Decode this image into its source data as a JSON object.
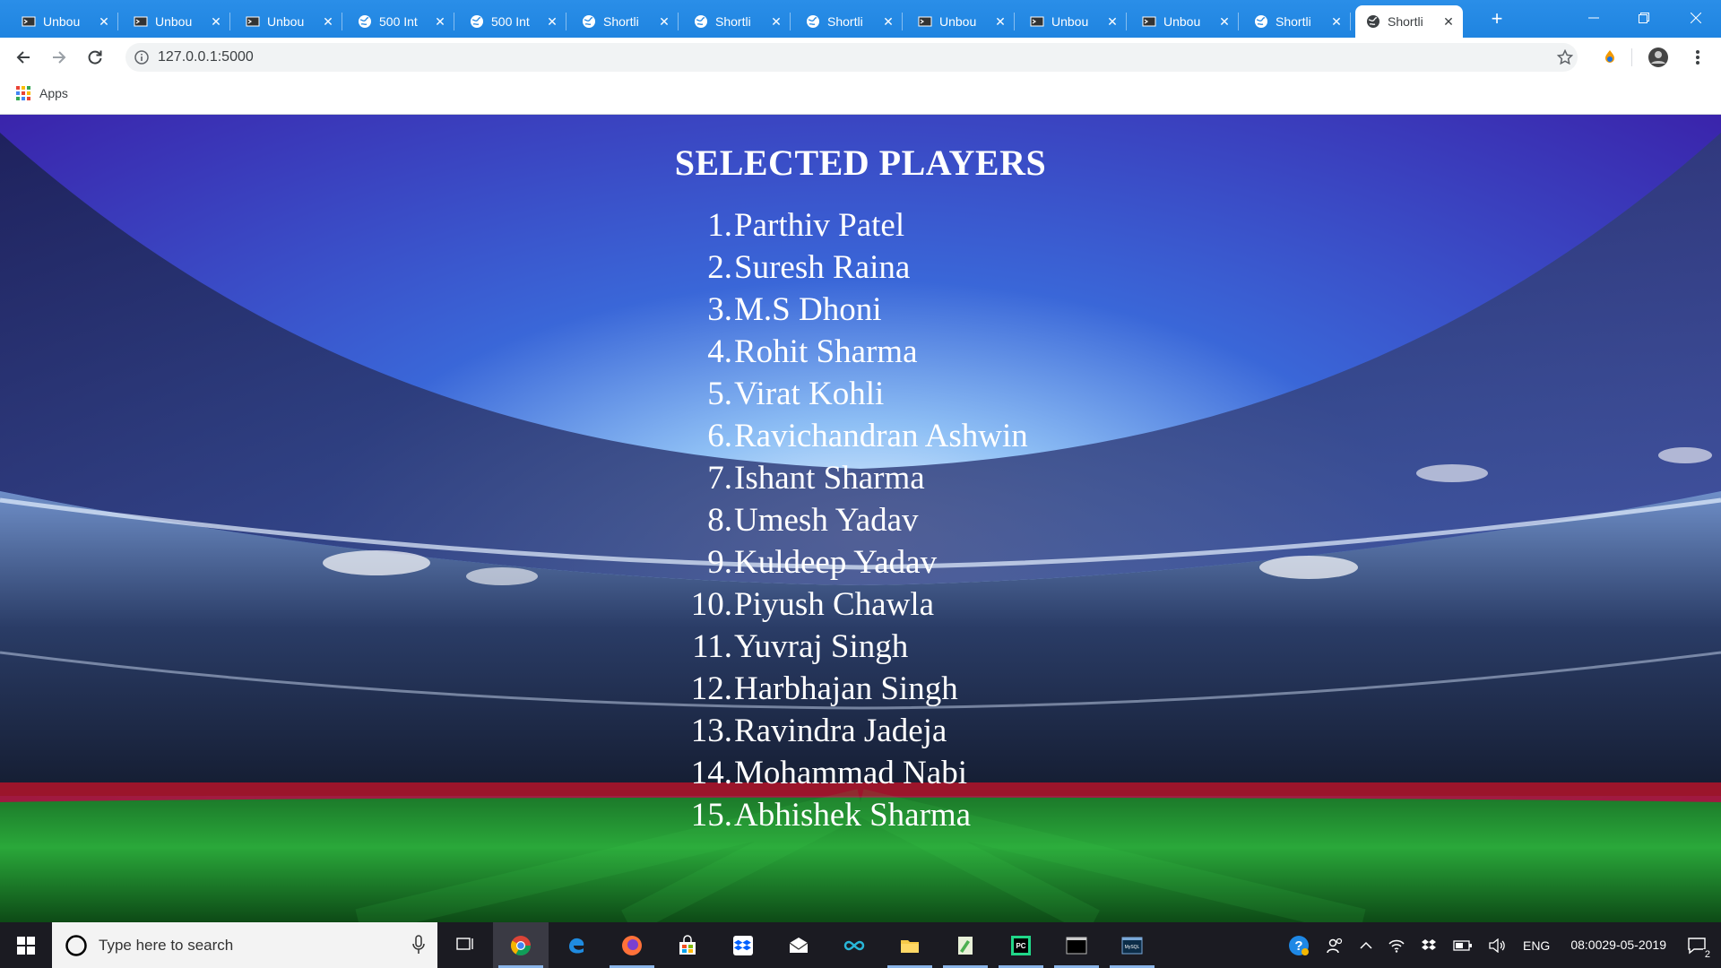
{
  "browser": {
    "tabs": [
      {
        "title": "Unbou",
        "icon": "terminal-icon",
        "active": false
      },
      {
        "title": "Unbou",
        "icon": "terminal-icon",
        "active": false
      },
      {
        "title": "Unbou",
        "icon": "terminal-icon",
        "active": false
      },
      {
        "title": "500 Int",
        "icon": "globe-icon",
        "active": false
      },
      {
        "title": "500 Int",
        "icon": "globe-icon",
        "active": false
      },
      {
        "title": "Shortli",
        "icon": "globe-icon",
        "active": false
      },
      {
        "title": "Shortli",
        "icon": "globe-icon",
        "active": false
      },
      {
        "title": "Shortli",
        "icon": "globe-icon",
        "active": false
      },
      {
        "title": "Unbou",
        "icon": "terminal-icon",
        "active": false
      },
      {
        "title": "Unbou",
        "icon": "terminal-icon",
        "active": false
      },
      {
        "title": "Unbou",
        "icon": "terminal-icon",
        "active": false
      },
      {
        "title": "Shortli",
        "icon": "globe-icon",
        "active": false
      },
      {
        "title": "Shortli",
        "icon": "globe-icon",
        "active": true
      }
    ],
    "new_tab_label": "+",
    "url": "127.0.0.1:5000",
    "bookmarks": {
      "apps_label": "Apps"
    },
    "accent_color": "#1f84e0"
  },
  "page": {
    "heading": "SELECTED PLAYERS",
    "players": [
      {
        "num": "1.",
        "name": "Parthiv Patel"
      },
      {
        "num": "2.",
        "name": "Suresh Raina"
      },
      {
        "num": "3.",
        "name": "M.S Dhoni"
      },
      {
        "num": "4.",
        "name": "Rohit Sharma"
      },
      {
        "num": "5.",
        "name": "Virat Kohli"
      },
      {
        "num": "6.",
        "name": "Ravichandran Ashwin"
      },
      {
        "num": "7.",
        "name": "Ishant Sharma"
      },
      {
        "num": "8.",
        "name": "Umesh Yadav"
      },
      {
        "num": "9.",
        "name": "Kuldeep Yadav"
      },
      {
        "num": "10.",
        "name": "Piyush Chawla"
      },
      {
        "num": "11.",
        "name": "Yuvraj Singh"
      },
      {
        "num": "12.",
        "name": "Harbhajan Singh"
      },
      {
        "num": "13.",
        "name": "Ravindra Jadeja"
      },
      {
        "num": "14.",
        "name": "Mohammad Nabi"
      },
      {
        "num": "15.",
        "name": "Abhishek Sharma"
      }
    ]
  },
  "taskbar": {
    "search_placeholder": "Type here to search",
    "apps": [
      {
        "name": "task-view-icon",
        "running": false
      },
      {
        "name": "chrome-icon",
        "running": true,
        "active": true
      },
      {
        "name": "edge-icon",
        "running": false
      },
      {
        "name": "firefox-icon",
        "running": true
      },
      {
        "name": "store-icon",
        "running": false
      },
      {
        "name": "dropbox-icon",
        "running": false
      },
      {
        "name": "mail-icon",
        "running": false
      },
      {
        "name": "infinity-icon",
        "running": false
      },
      {
        "name": "file-explorer-icon",
        "running": true
      },
      {
        "name": "notepad-icon",
        "running": true
      },
      {
        "name": "pycharm-icon",
        "running": true
      },
      {
        "name": "cmd-icon",
        "running": true
      },
      {
        "name": "mysql-icon",
        "running": true
      }
    ],
    "language": "ENG",
    "time": "08:00",
    "date": "29-05-2019",
    "notification_count": "2"
  }
}
